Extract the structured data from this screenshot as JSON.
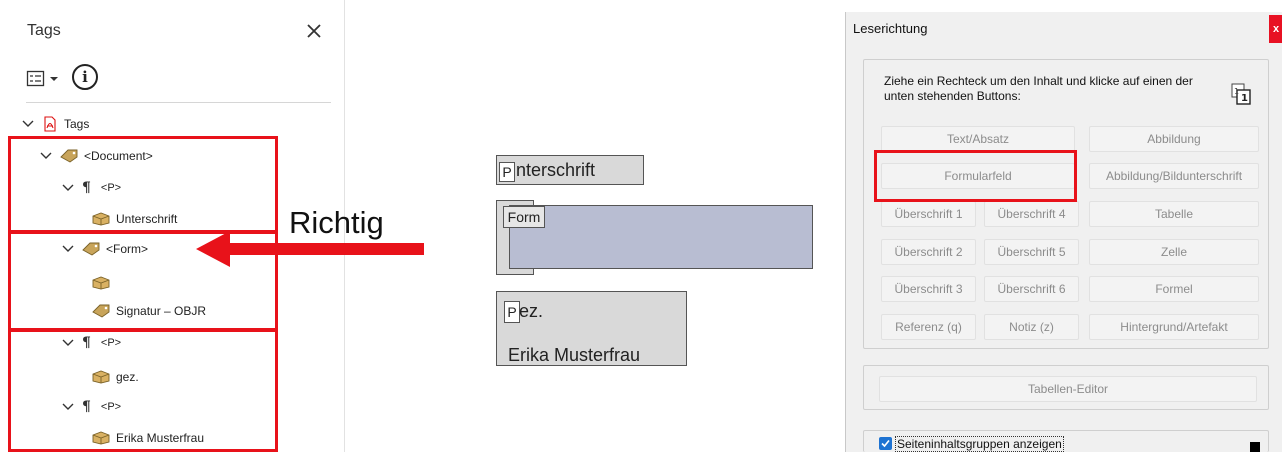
{
  "tags_panel": {
    "title": "Tags",
    "tree": [
      {
        "label": "Tags"
      },
      {
        "label": "<Document>"
      },
      {
        "label": "<P>"
      },
      {
        "label": "Unterschrift"
      },
      {
        "label": "<Form>"
      },
      {
        "label": ""
      },
      {
        "label": "Signatur – OBJR"
      },
      {
        "label": "<P>"
      },
      {
        "label": "gez."
      },
      {
        "label": "<P>"
      },
      {
        "label": "Erika Musterfrau"
      }
    ]
  },
  "annotation": {
    "label": "Richtig",
    "color": "#e8121a"
  },
  "page": {
    "boxes": [
      {
        "letter": "P",
        "text": "nterschrift"
      },
      {
        "letter": "Form"
      },
      {
        "letter": "P",
        "text": "ez.",
        "text2": "Erika Musterfrau"
      }
    ],
    "form_field_color": "#b8bdd2"
  },
  "reading_panel": {
    "title": "Leserichtung",
    "close": "x",
    "instruction": "Ziehe ein Rechteck um den Inhalt und klicke auf einen der unten stehenden Buttons:",
    "buttons": {
      "text_absatz": "Text/Absatz",
      "abbildung": "Abbildung",
      "formularfeld": "Formularfeld",
      "abbildung_bildunterschrift": "Abbildung/Bildunterschrift",
      "h1": "Überschrift 1",
      "h4": "Überschrift 4",
      "tabelle": "Tabelle",
      "h2": "Überschrift 2",
      "h5": "Überschrift 5",
      "zelle": "Zelle",
      "h3": "Überschrift 3",
      "h6": "Überschrift 6",
      "formel": "Formel",
      "referenz": "Referenz (q)",
      "notiz": "Notiz (z)",
      "hintergrund": "Hintergrund/Artefakt"
    },
    "tabellen_editor": "Tabellen-Editor",
    "checkbox_label": "Seiteninhaltsgruppen anzeigen",
    "checkbox_checked": true
  }
}
